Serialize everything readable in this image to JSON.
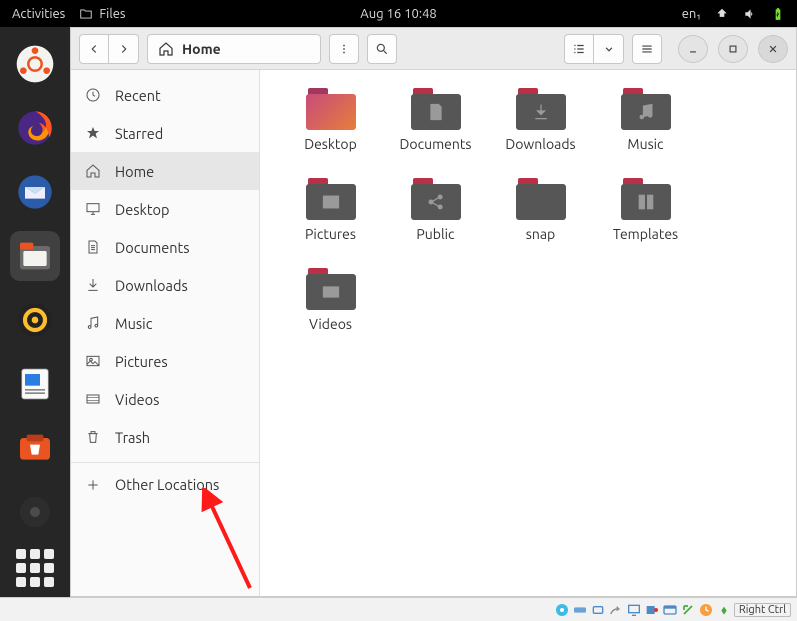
{
  "panel": {
    "activities": "Activities",
    "app_name": "Files",
    "datetime": "Aug 16  10:48",
    "lang": "en₁"
  },
  "titlebar": {
    "location": "Home"
  },
  "sidebar": {
    "items": [
      {
        "label": "Recent",
        "icon": "clock"
      },
      {
        "label": "Starred",
        "icon": "star"
      },
      {
        "label": "Home",
        "icon": "home",
        "active": true
      },
      {
        "label": "Desktop",
        "icon": "desktop"
      },
      {
        "label": "Documents",
        "icon": "document"
      },
      {
        "label": "Downloads",
        "icon": "download"
      },
      {
        "label": "Music",
        "icon": "music"
      },
      {
        "label": "Pictures",
        "icon": "picture"
      },
      {
        "label": "Videos",
        "icon": "video"
      },
      {
        "label": "Trash",
        "icon": "trash"
      }
    ],
    "other": "Other Locations"
  },
  "folders": [
    {
      "label": "Desktop",
      "variant": "desktop"
    },
    {
      "label": "Documents",
      "glyph": "document"
    },
    {
      "label": "Downloads",
      "glyph": "download"
    },
    {
      "label": "Music",
      "glyph": "music"
    },
    {
      "label": "Pictures",
      "glyph": "picture"
    },
    {
      "label": "Public",
      "glyph": "share"
    },
    {
      "label": "snap",
      "glyph": ""
    },
    {
      "label": "Templates",
      "glyph": "template"
    },
    {
      "label": "Videos",
      "glyph": "video"
    }
  ],
  "statusbar": {
    "host_key": "Right Ctrl"
  }
}
